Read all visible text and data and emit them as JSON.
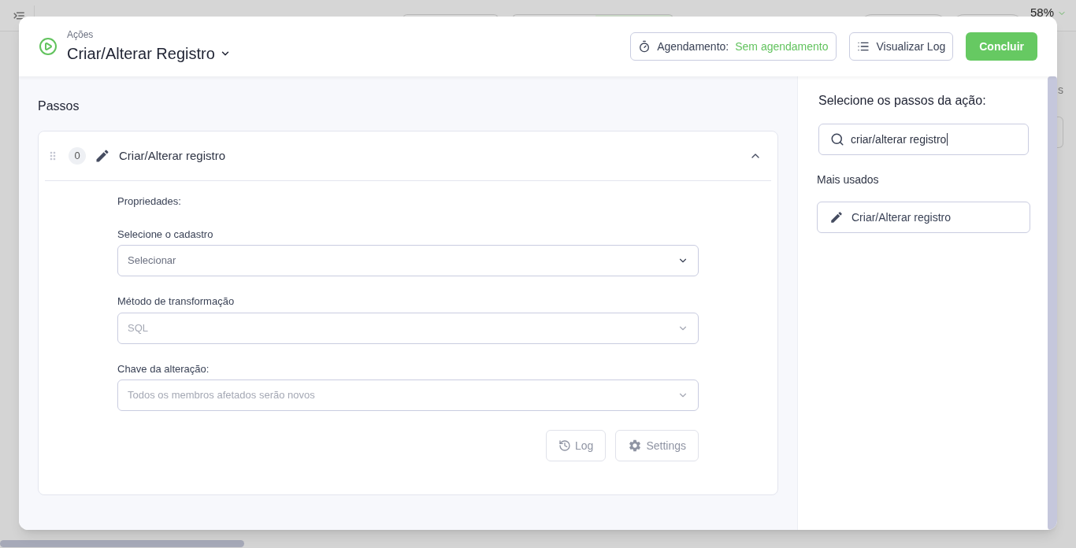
{
  "background": {
    "app_bar": {
      "modes": [
        {
          "selected": false
        },
        {
          "selected": true
        }
      ],
      "zoom": "58%"
    },
    "side_fragment": "s"
  },
  "modal": {
    "breadcrumb": "Ações",
    "title": "Criar/Alterar Registro",
    "schedule": {
      "label": "Agendamento:",
      "value": "Sem agendamento"
    },
    "log_button": "Visualizar Log",
    "confirm_button": "Concluir"
  },
  "steps": {
    "heading": "Passos",
    "items": [
      {
        "index": "0",
        "name": "Criar/Alterar registro",
        "expanded": true,
        "properties_label": "Propriedades:",
        "fields": [
          {
            "label": "Selecione o cadastro",
            "placeholder": "Selecionar",
            "disabled": false
          },
          {
            "label": "Método de transformação",
            "value": "SQL",
            "disabled": true
          },
          {
            "label": "Chave da alteração:",
            "value": "Todos os membros afetados serão novos",
            "disabled": true
          }
        ],
        "actions": [
          {
            "kind": "log",
            "label": "Log"
          },
          {
            "kind": "settings",
            "label": "Settings"
          }
        ]
      }
    ]
  },
  "picker": {
    "heading": "Selecione os passos da ação:",
    "search": {
      "value": "criar/alterar registro"
    },
    "section": "Mais usados",
    "items": [
      "Criar/Alterar registro"
    ]
  }
}
